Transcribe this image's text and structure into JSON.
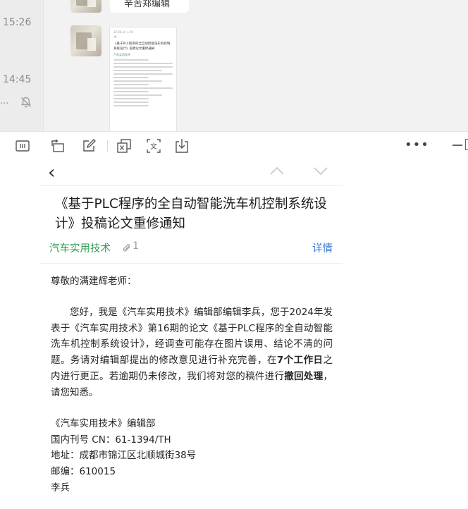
{
  "chat": {
    "times": [
      "15:26",
      "14:45"
    ],
    "preview_ellipsis": "...",
    "bubble_text": "辛苦郑编辑",
    "mini_mail": {
      "status": "12:26 ull ◇ 91",
      "back": "<",
      "title": "《基于PLC程序的全自动智能洗车机控制系统设计》投稿论文重修通知",
      "sender": "汽车实用技术"
    }
  },
  "toolbar": {
    "more_label": "•••"
  },
  "mail": {
    "nav": {
      "back": "‹"
    },
    "title": "《基于PLC程序的全自动智能洗车机控制系统设计》投稿论文重修通知",
    "sender": "汽车实用技术",
    "attachment_count": "1",
    "details_label": "详情",
    "greeting": "尊敬的满建辉老师：",
    "body": {
      "p1": "您好，我是《汽车实用技术》编辑部编辑李兵，您于2024年发表于《汽车实用技术》第16期的论文《基于PLC程序的全自动智能洗车机控制系统设计》，经调查可能存在图片误用、结论不清的问题。务请对编辑部提出的修改意见进行补充完善，在",
      "bold1": "7个工作日",
      "p2": "之内进行更正。若逾期仍未修改，我们将对您的稿件进行",
      "bold2": "撤回处理",
      "p3": "，请您知悉。"
    },
    "signature": {
      "org": "《汽车实用技术》编辑部",
      "issn": "国内刊号 CN：61-1394/TH",
      "address": "地址：成都市锦江区北顺城街38号",
      "postcode": "邮编：610015",
      "name": "李兵"
    }
  },
  "colors": {
    "sender_green": "#2f9e57",
    "link_blue": "#3b7bd4"
  },
  "icons": [
    "mute-icon",
    "reader-mode-icon",
    "rotate-icon",
    "edit-icon",
    "translate-icon",
    "ocr-icon",
    "download-icon",
    "chevron-up-icon",
    "chevron-down-icon",
    "paperclip-icon"
  ]
}
